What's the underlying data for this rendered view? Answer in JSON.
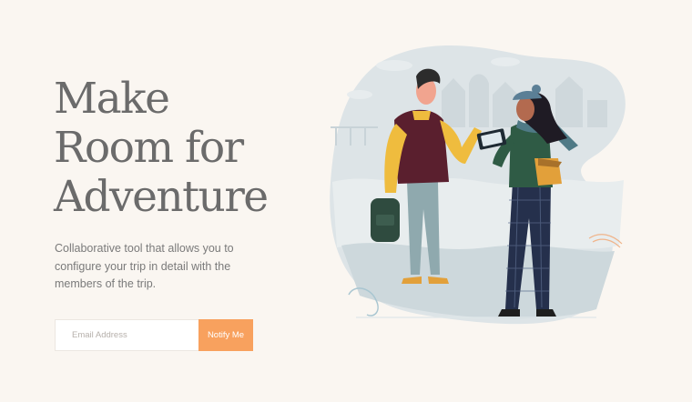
{
  "hero": {
    "title_lines": [
      "Make",
      "Room for",
      "Adventure"
    ],
    "description": "Collaborative tool that allows you to configure your trip in detail with the members of the trip."
  },
  "signup": {
    "email_placeholder": "Email Address",
    "email_value": "",
    "button_label": "Notify Me"
  },
  "colors": {
    "background": "#faf6f1",
    "accent": "#f8a15e",
    "title": "#6b6b6b",
    "body_text": "#7a7a7a"
  },
  "illustration": {
    "description_icon": "travelers-illustration"
  }
}
